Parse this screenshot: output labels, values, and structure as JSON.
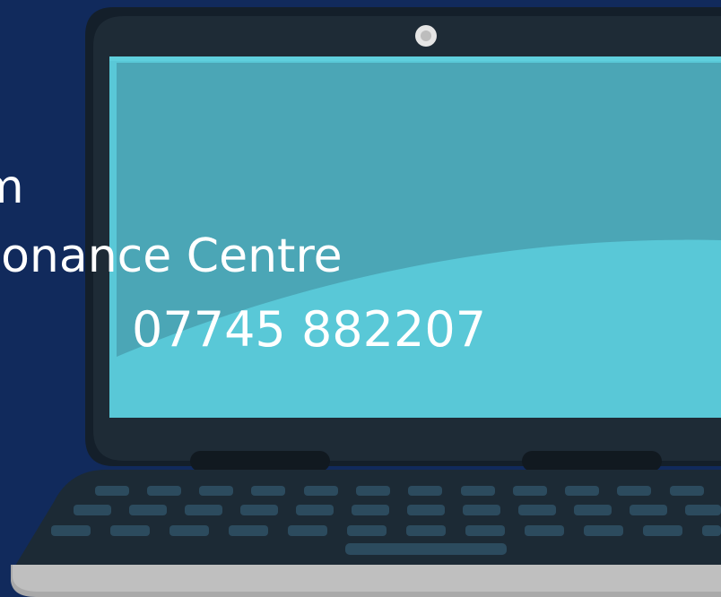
{
  "text_lines": {
    "line1": "m",
    "line2": "sonance Centre",
    "line3": "07745 882207"
  },
  "colors": {
    "background": "#112a5c",
    "laptop_bezel": "#1e2b36",
    "screen_top": "#4ba6b6",
    "screen_bottom": "#59c8d7",
    "keyboard_keys": "#2c4b5e",
    "base": "#bfbfbf",
    "text": "#ffffff"
  },
  "icons": {
    "camera": "webcam-icon",
    "device": "laptop-icon"
  }
}
